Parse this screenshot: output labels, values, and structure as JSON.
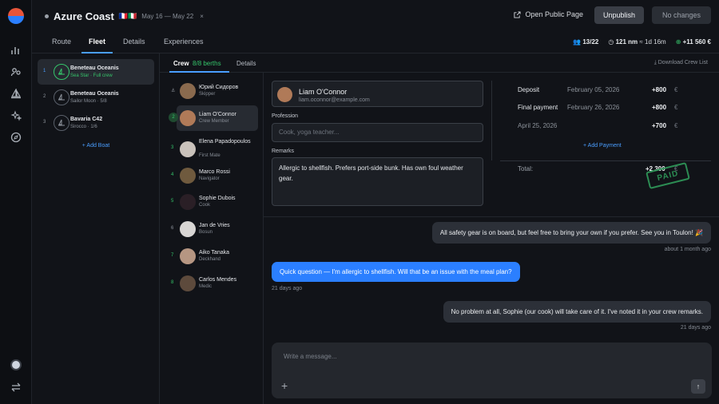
{
  "trip": {
    "title": "Azure Coast",
    "flags": "🇫🇷🇮🇹",
    "dates": "May 16 — May 22",
    "close": "×"
  },
  "header": {
    "open_public": "Open Public Page",
    "unpublish": "Unpublish",
    "no_changes": "No changes"
  },
  "tabs": [
    "Route",
    "Fleet",
    "Details",
    "Experiences"
  ],
  "stats": {
    "berths": "13/22",
    "distance": "121 nm",
    "duration": "≈ 1d 16m",
    "revenue": "+11 560 €"
  },
  "boats": [
    {
      "num": "1",
      "name": "Beneteau Oceanis",
      "sub": "Sea Star · Full crew"
    },
    {
      "num": "2",
      "name": "Beneteau Oceanis",
      "sub": "Sailor Moon · 5/8"
    },
    {
      "num": "3",
      "name": "Bavaria C42",
      "sub": "Sirocco · 1/6"
    }
  ],
  "add_boat": "+ Add Boat",
  "crew_tabs": {
    "crew": "Crew",
    "berths": "8/8 berths",
    "details": "Details",
    "download": "Download Crew List"
  },
  "crew": [
    {
      "num": "⚓",
      "name": "Юрий Сидоров",
      "role": "Skipper"
    },
    {
      "num": "2",
      "name": "Liam O'Connor",
      "role": "Crew Member"
    },
    {
      "num": "3",
      "name": "Elena Papadopoulos",
      "role": "First Mate"
    },
    {
      "num": "4",
      "name": "Marco Rossi",
      "role": "Navigator"
    },
    {
      "num": "5",
      "name": "Sophie Dubois",
      "role": "Cook"
    },
    {
      "num": "6",
      "name": "Jan de Vries",
      "role": "Bosun"
    },
    {
      "num": "7",
      "name": "Aiko Tanaka",
      "role": "Deckhand"
    },
    {
      "num": "8",
      "name": "Carlos Mendes",
      "role": "Medic"
    }
  ],
  "person": {
    "name": "Liam O'Connor",
    "email": "liam.oconnor@example.com"
  },
  "profession": {
    "label": "Profession",
    "placeholder": "Cook, yoga teacher..."
  },
  "remarks": {
    "label": "Remarks",
    "value": "Allergic to shellfish. Prefers port-side bunk. Has own foul weather gear."
  },
  "payments": [
    {
      "label": "Deposit",
      "date": "February 05, 2026",
      "amount": "+800",
      "currency": "€"
    },
    {
      "label": "Final payment",
      "date": "February 26, 2026",
      "amount": "+800",
      "currency": "€"
    },
    {
      "label": "",
      "date": "April 25, 2026",
      "amount": "+700",
      "currency": "€"
    }
  ],
  "add_payment": "+ Add Payment",
  "total": {
    "label": "Total:",
    "amount": "+2 300",
    "currency": "€",
    "stamp": "PAID"
  },
  "messages": [
    {
      "text": "All safety gear is on board, but feel free to bring your own if you prefer. See you in Toulon! 🎉",
      "time": "about 1 month ago"
    },
    {
      "text": "Quick question — I'm allergic to shellfish. Will that be an issue with the meal plan?",
      "time": "21 days ago"
    },
    {
      "text": "No problem at all, Sophie (our cook) will take care of it. I've noted it in your crew remarks.",
      "time": "21 days ago"
    }
  ],
  "composer": {
    "placeholder": "Write a message...",
    "plus": "+",
    "send": "↑"
  },
  "colors": {
    "accent": "#4a9eff",
    "green": "#35c46a",
    "bubble_out": "#2b7fff",
    "bg": "#111318"
  }
}
